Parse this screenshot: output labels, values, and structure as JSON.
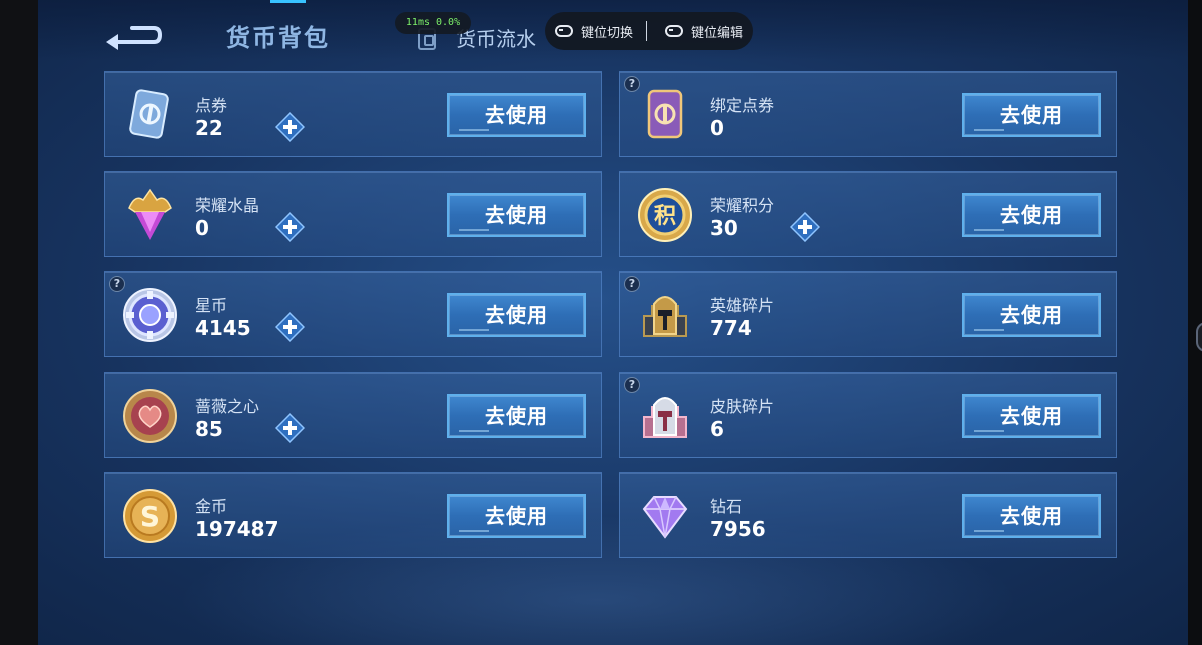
{
  "header": {
    "title": "货币背包",
    "tab_flow": "货币流水",
    "perf_overlay": "11ms  0.0%",
    "overlay_buttons": {
      "switch": "键位切换",
      "edit": "键位编辑"
    }
  },
  "colors": {
    "accent": "#38c3ff",
    "button": "#3f87cf",
    "card_border": "#5d8fd6",
    "title": "#8fb6e3"
  },
  "currencies": [
    {
      "name": "点券",
      "amount": "22",
      "action": "去使用",
      "icon": "ticket-card-icon"
    },
    {
      "name": "绑定点券",
      "amount": "0",
      "action": "去使用",
      "icon": "bound-ticket-card-icon"
    },
    {
      "name": "荣耀水晶",
      "amount": "0",
      "action": "去使用",
      "icon": "glory-crystal-icon"
    },
    {
      "name": "荣耀积分",
      "amount": "30",
      "action": "去使用",
      "icon": "glory-points-coin-icon"
    },
    {
      "name": "星币",
      "amount": "4145",
      "action": "去使用",
      "icon": "star-coin-icon"
    },
    {
      "name": "英雄碎片",
      "amount": "774",
      "action": "去使用",
      "icon": "hero-fragment-helmet-icon"
    },
    {
      "name": "蔷薇之心",
      "amount": "85",
      "action": "去使用",
      "icon": "rose-heart-coin-icon"
    },
    {
      "name": "皮肤碎片",
      "amount": "6",
      "action": "去使用",
      "icon": "skin-fragment-helmet-icon"
    },
    {
      "name": "金币",
      "amount": "197487",
      "action": "去使用",
      "icon": "gold-coin-icon"
    },
    {
      "name": "钻石",
      "amount": "7956",
      "action": "去使用",
      "icon": "diamond-icon"
    }
  ]
}
